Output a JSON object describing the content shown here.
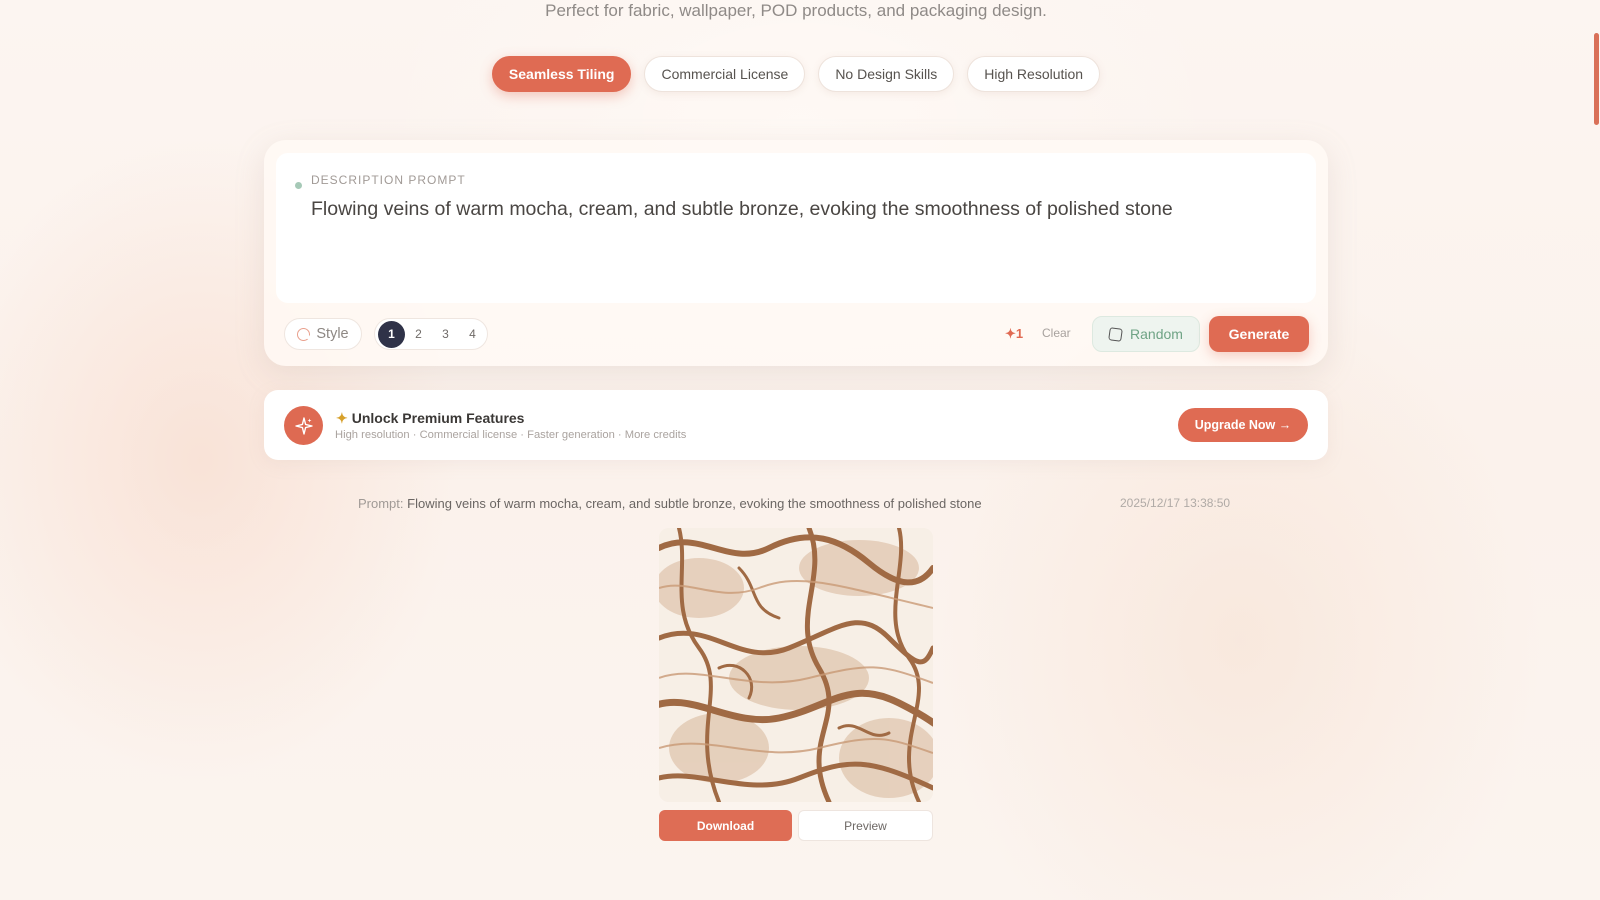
{
  "header": {
    "subtitle": "Perfect for fabric, wallpaper, POD products, and packaging design."
  },
  "feature_chips": [
    {
      "label": "Seamless Tiling",
      "active": true
    },
    {
      "label": "Commercial License",
      "active": false
    },
    {
      "label": "No Design Skills",
      "active": false
    },
    {
      "label": "High Resolution",
      "active": false
    }
  ],
  "prompt_panel": {
    "label": "DESCRIPTION PROMPT",
    "value": "Flowing veins of warm mocha, cream, and subtle bronze, evoking the smoothness of polished stone",
    "style_label": "Style",
    "counts": [
      "1",
      "2",
      "3",
      "4"
    ],
    "selected_count": "1",
    "credit_cost": "✦1",
    "clear_label": "Clear",
    "random_label": "Random",
    "generate_label": "Generate"
  },
  "premium_banner": {
    "title": "Unlock Premium Features",
    "subtitle": "High resolution · Commercial license · Faster generation · More credits",
    "button_label": "Upgrade Now →",
    "icon": "sparkle-icon"
  },
  "result": {
    "prompt_label": "Prompt:",
    "prompt_text": "Flowing veins of warm mocha, cream, and subtle bronze, evoking the smoothness of polished stone",
    "timestamp": "2025/12/17 13:38:50",
    "download_label": "Download",
    "preview_label": "Preview"
  },
  "colors": {
    "accent": "#df6b53",
    "dark_pill": "#2f3248",
    "random_green": "#6fa385",
    "marble_vein": "#a8714a",
    "marble_cream": "#f7efe6"
  }
}
